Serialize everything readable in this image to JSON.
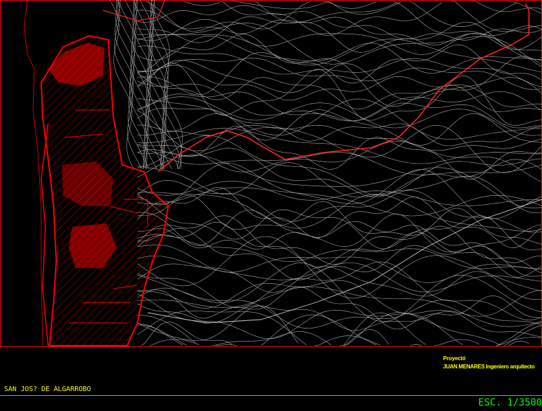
{
  "title_block": {
    "project_label": "Proyectó",
    "author": "JUAN MENARES Ingeniero arquitecto",
    "place_name": "SAN JOS? DE ALGARROBO",
    "scale": "ESC. 1/3500"
  },
  "colors": {
    "background": "#000000",
    "frame_line": "#ff0000",
    "urban_zone": "#ff0000",
    "contours": "#bfbfbf",
    "road": "#ff2020",
    "title_text": "#ffff00",
    "scale_text": "#00ff00",
    "divider": "#00ff00"
  }
}
